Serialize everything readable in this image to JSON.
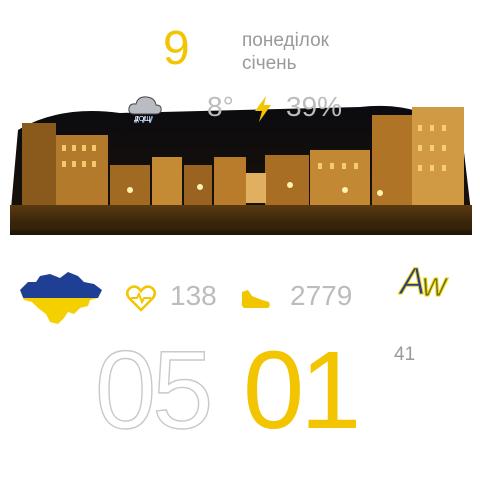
{
  "date": {
    "day": "9",
    "weekday": "понеділок",
    "month": "січень"
  },
  "weather": {
    "icon": "cloud-rain-icon",
    "condition": "ДОЩ",
    "temperature": "8°"
  },
  "battery": {
    "icon": "lightning-bolt-icon",
    "percent": "39%"
  },
  "health": {
    "heart_icon": "heart-pulse-icon",
    "pulse": "138",
    "steps_icon": "sneaker-icon",
    "steps": "2779"
  },
  "branding": {
    "map_icon": "ukraine-map-icon",
    "logo": "AW"
  },
  "time": {
    "hours": "05",
    "minutes": "01",
    "seconds": "41"
  },
  "colors": {
    "accent": "#f2c500",
    "muted": "#9a9a9a",
    "flag_blue": "#1f3f95",
    "flag_yellow": "#f5d000"
  }
}
